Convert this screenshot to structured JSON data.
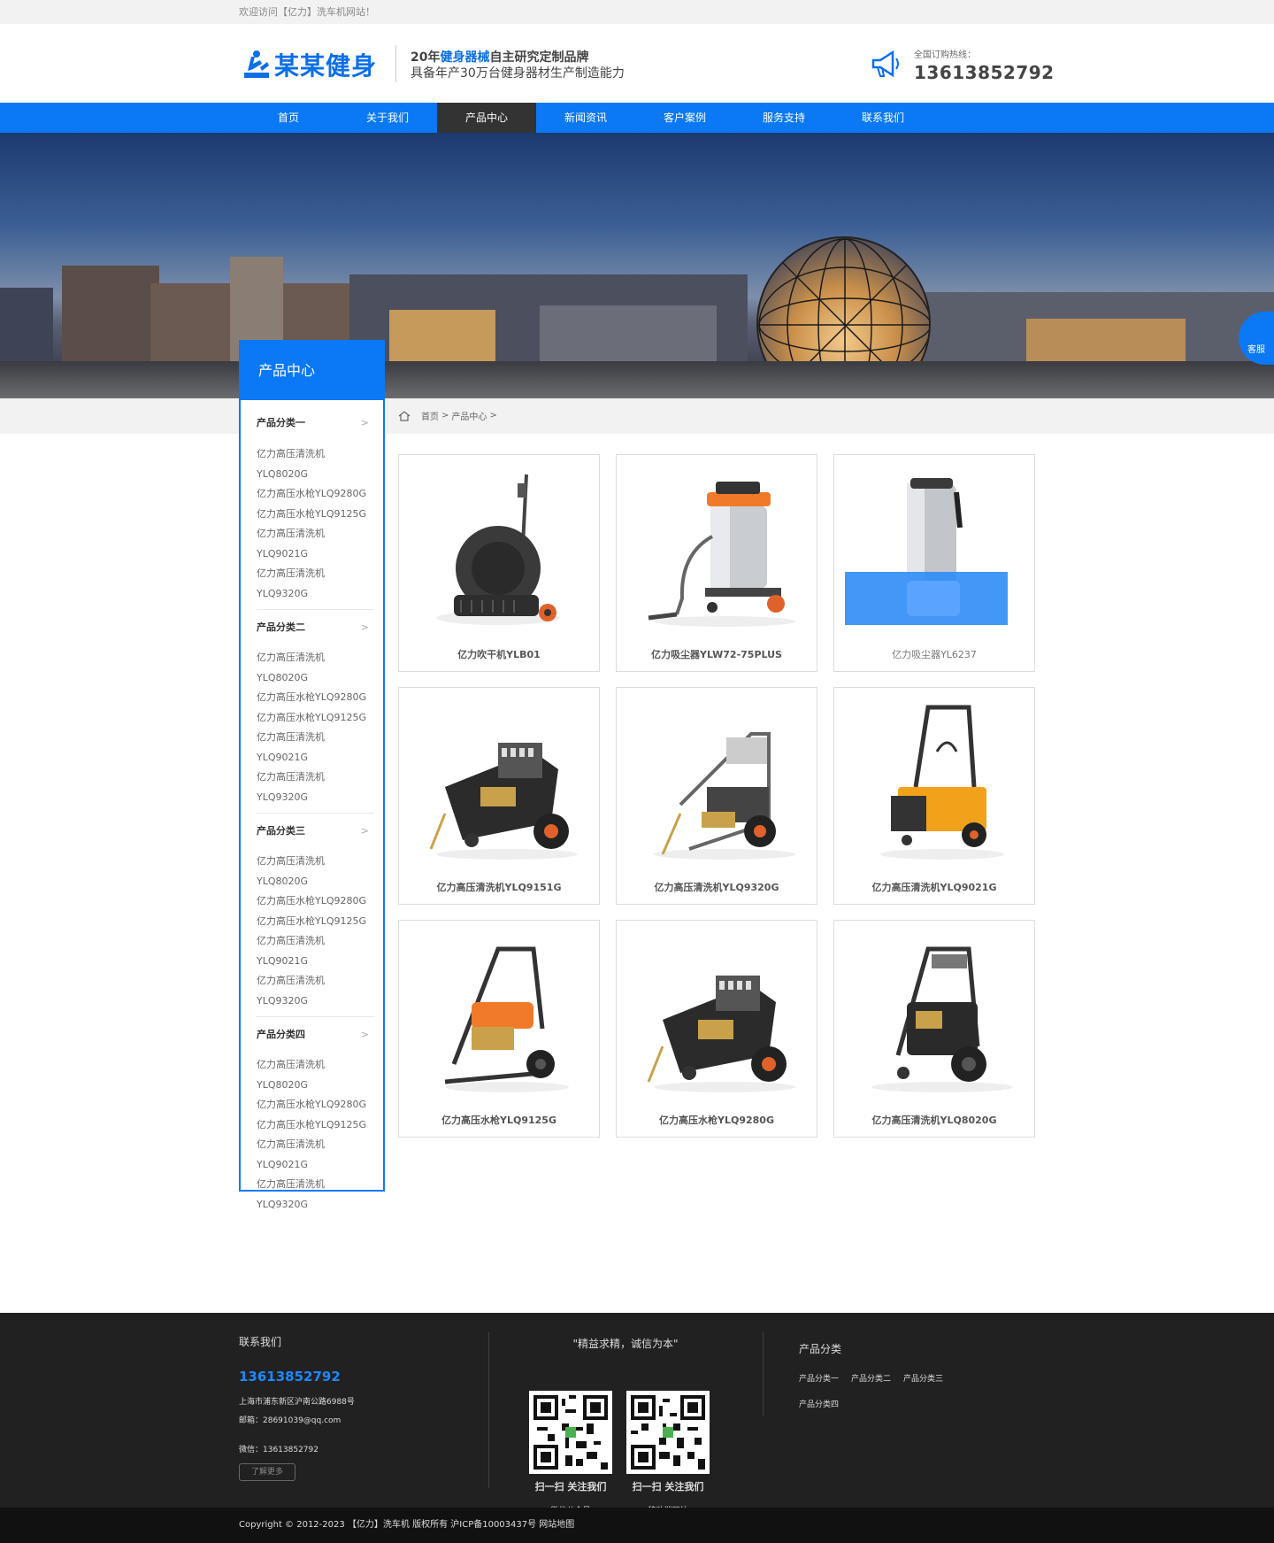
{
  "topbar": {
    "welcome": "欢迎访问【亿力】洗车机网站！"
  },
  "header": {
    "logo_text": "某某健身",
    "slogan_pre": "20年",
    "slogan_hl": "健身器械",
    "slogan_post": "自主研究定制品牌",
    "slogan_line2": "具备年产30万台健身器材生产制造能力",
    "hotline_label": "全国订购热线：",
    "hotline_number": "13613852792",
    "brand_color": "#0b78f5"
  },
  "nav": [
    "首页",
    "关于我们",
    "产品中心",
    "新闻资讯",
    "客户案例",
    "服务支持",
    "联系我们"
  ],
  "side_service": "客服",
  "sidebar": {
    "title": "产品中心",
    "categories": [
      {
        "title": "产品分类一",
        "items": [
          "亿力高压清洗机",
          "YLQ8020G",
          "亿力高压水枪YLQ9280G",
          "亿力高压水枪YLQ9125G",
          "亿力高压清洗机",
          "YLQ9021G",
          "亿力高压清洗机",
          "YLQ9320G"
        ]
      },
      {
        "title": "产品分类二",
        "items": [
          "亿力高压清洗机",
          "YLQ8020G",
          "亿力高压水枪YLQ9280G",
          "亿力高压水枪YLQ9125G",
          "亿力高压清洗机",
          "YLQ9021G",
          "亿力高压清洗机",
          "YLQ9320G"
        ]
      },
      {
        "title": "产品分类三",
        "items": [
          "亿力高压清洗机",
          "YLQ8020G",
          "亿力高压水枪YLQ9280G",
          "亿力高压水枪YLQ9125G",
          "亿力高压清洗机",
          "YLQ9021G",
          "亿力高压清洗机",
          "YLQ9320G"
        ]
      },
      {
        "title": "产品分类四",
        "items": [
          "亿力高压清洗机",
          "YLQ8020G",
          "亿力高压水枪YLQ9280G",
          "亿力高压水枪YLQ9125G",
          "亿力高压清洗机",
          "YLQ9021G",
          "亿力高压清洗机",
          "YLQ9320G"
        ]
      }
    ]
  },
  "breadcrumb": {
    "home": "首页",
    "sep": ">",
    "current": "产品中心"
  },
  "products": [
    "亿力吹干机YLB01",
    "亿力吸尘器YLW72-75PLUS",
    "亿力吸尘器YL6237",
    "亿力高压清洗机YLQ9151G",
    "亿力高压清洗机YLQ9320G",
    "亿力高压清洗机YLQ9021G",
    "亿力高压水枪YLQ9125G",
    "亿力高压水枪YLQ9280G",
    "亿力高压清洗机YLQ8020G"
  ],
  "footer": {
    "contact_title": "联系我们",
    "phone": "13613852792",
    "address": "上海市浦东新区沪南公路6988号",
    "email": "邮箱：28691039@qq.com",
    "wechat": "微信：13613852792",
    "more": "了解更多",
    "motto": "\"精益求精，诚信为本\"",
    "qr": [
      {
        "scan": "扫一扫 关注我们",
        "sub": "微信公众号"
      },
      {
        "scan": "扫一扫 关注我们",
        "sub": "移动端网站"
      }
    ],
    "cat_title": "产品分类",
    "cat_links": [
      "产品分类一",
      "产品分类二",
      "产品分类三",
      "产品分类四"
    ]
  },
  "copyright": "Copyright © 2012-2023 【亿力】洗车机 版权所有 沪ICP备10003437号 网站地图"
}
